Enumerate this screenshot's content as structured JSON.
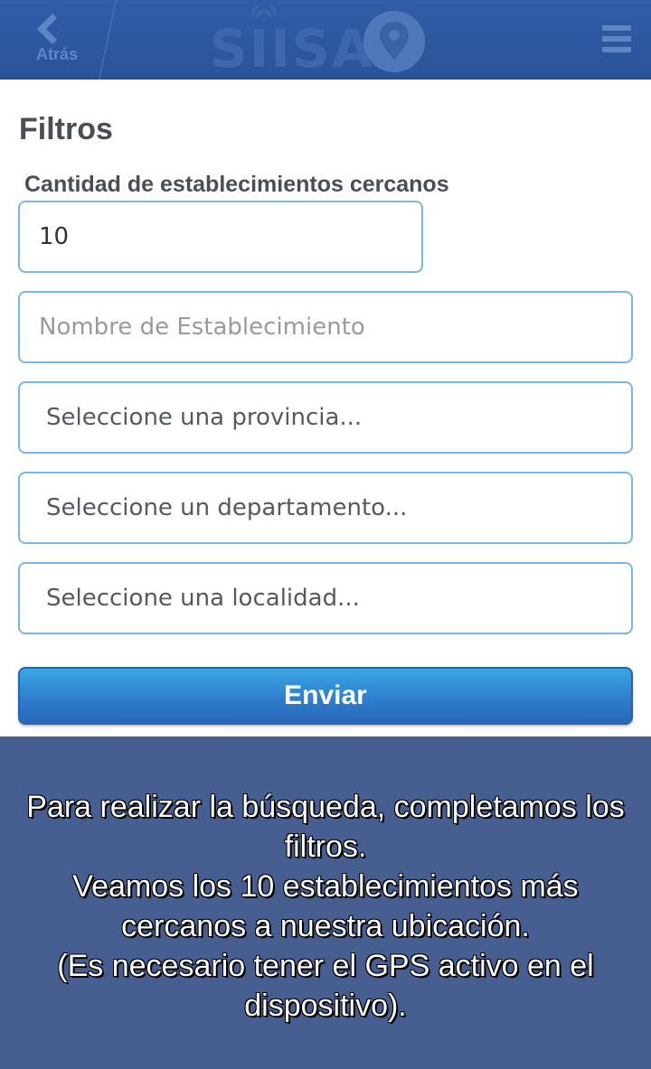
{
  "header": {
    "back_label": "Atrás",
    "logo_text": "SIISA",
    "colors": {
      "bar": "#2f5da7",
      "accent": "#5f86c4"
    }
  },
  "form": {
    "title": "Filtros",
    "quantity_label": "Cantidad de establecimientos cercanos",
    "quantity_value": "10",
    "name_placeholder": "Nombre de Establecimiento",
    "province_select": "Seleccione una provincia...",
    "department_select": "Seleccione un departamento...",
    "locality_select": "Seleccione una localidad...",
    "submit_label": "Enviar"
  },
  "overlay": {
    "lines": [
      "Para realizar la búsqueda, completamos los filtros.",
      "Veamos los 10 establecimientos más cercanos a nuestra ubicación.",
      "(Es necesario tener el GPS activo en el dispositivo)."
    ],
    "background": "#475e91"
  }
}
